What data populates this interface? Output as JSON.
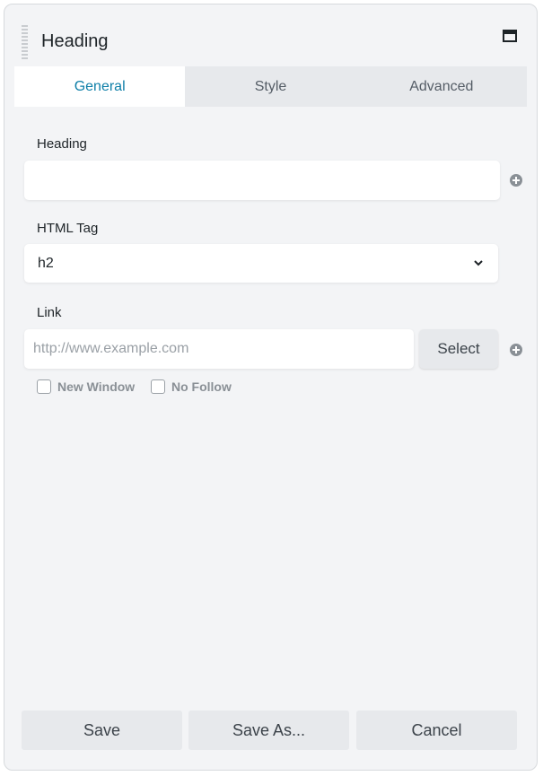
{
  "header": {
    "title": "Heading"
  },
  "tabs": [
    {
      "label": "General",
      "active": true
    },
    {
      "label": "Style",
      "active": false
    },
    {
      "label": "Advanced",
      "active": false
    }
  ],
  "fields": {
    "heading": {
      "label": "Heading",
      "value": "",
      "placeholder": ""
    },
    "html_tag": {
      "label": "HTML Tag",
      "value": "h2"
    },
    "link": {
      "label": "Link",
      "value": "",
      "placeholder": "http://www.example.com",
      "select_label": "Select",
      "new_window_label": "New Window",
      "no_follow_label": "No Follow"
    }
  },
  "footer": {
    "save_label": "Save",
    "save_as_label": "Save As...",
    "cancel_label": "Cancel"
  },
  "colors": {
    "accent": "#0e7fa8",
    "panel_bg": "#f3f4f6"
  },
  "icons": [
    "drag-handle-icon",
    "maximize-icon",
    "chevron-down-icon",
    "plus-circle-icon"
  ]
}
